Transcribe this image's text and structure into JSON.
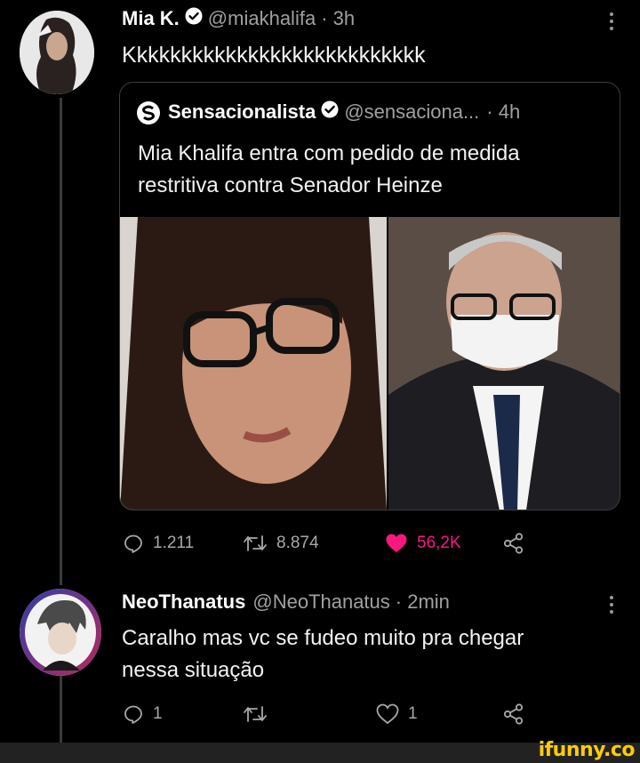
{
  "tweet1": {
    "name": "Mia K.",
    "handle": "@miakhalifa",
    "time": "· 3h",
    "text": "Kkkkkkkkkkkkkkkkkkkkkkkkkkk",
    "quote": {
      "name": "Sensacionalista",
      "handle": "@sensaciona...",
      "time": "· 4h",
      "text_line1": "Mia Khalifa entra com pedido de medida",
      "text_line2": "restritiva contra Senador Heinze"
    },
    "actions": {
      "replies": "1.211",
      "retweets": "8.874",
      "likes": "56,2K",
      "liked": true
    }
  },
  "tweet2": {
    "name": "NeoThanatus",
    "handle": "@NeoThanatus",
    "time": "· 2min",
    "text_line1": "Caralho mas vc se fudeo muito pra chegar",
    "text_line2": "nessa situação",
    "actions": {
      "replies": "1",
      "retweets": "",
      "likes": "1"
    }
  },
  "watermark": "ifunny.co",
  "colors": {
    "background": "#000000",
    "like_active": "#f91880",
    "verified": "#ffffff",
    "muted_text": "#a0a0a0",
    "watermark": "#ffcc00"
  }
}
